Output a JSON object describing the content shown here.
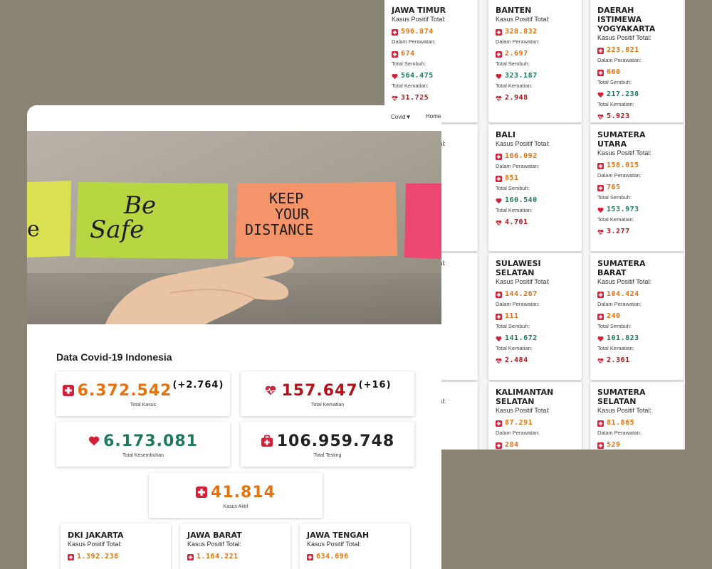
{
  "nav": {
    "covid_label": "Covid",
    "home_label": "Home"
  },
  "hero": {
    "note_left": "e",
    "note_be": "Be",
    "note_safe": "Safe",
    "note_keep": "KEEP",
    "note_your": "YOUR",
    "note_distance": "DISTANCE"
  },
  "main": {
    "title": "Data Covid-19 Indonesia",
    "total_kasus": {
      "value": "6.372.542",
      "delta": "(+2.764)",
      "caption": "Total Kasus"
    },
    "total_kematian": {
      "value": "157.647",
      "delta": "(+16)",
      "caption": "Total Kematian"
    },
    "total_kesembuhan": {
      "value": "6.173.081",
      "caption": "Total Kesembuhan"
    },
    "total_testing": {
      "value": "106.959.748",
      "caption": "Total Testing"
    },
    "kasus_aktif": {
      "value": "41.814",
      "caption": "Kasus Aktif"
    }
  },
  "labels": {
    "positif": "Kasus Positif Total:",
    "perawatan": "Dalam Perawatan:",
    "sembuh": "Total Sembuh:",
    "kematian": "Total Kematian:"
  },
  "front_provinces": [
    {
      "name": "DKI JAKARTA",
      "positif": "1.392.238"
    },
    {
      "name": "JAWA BARAT",
      "positif": "1.164.221"
    },
    {
      "name": "JAWA TENGAH",
      "positif": "634.696"
    }
  ],
  "back_provinces": [
    {
      "name": "JAWA TIMUR",
      "positif": "596.874",
      "perawatan": "674",
      "sembuh": "564.475",
      "kematian": "31.725"
    },
    {
      "name": "BANTEN",
      "positif": "328.832",
      "perawatan": "2.697",
      "sembuh": "323.187",
      "kematian": "2.948"
    },
    {
      "name": "DAERAH ISTIMEWA YOGYAKARTA",
      "positif": "223.821",
      "perawatan": "660",
      "sembuh": "217.238",
      "kematian": "5.923"
    },
    {
      "name": "H TIMUR",
      "positif": "",
      "perawatan": "",
      "sembuh": "",
      "kematian": ""
    },
    {
      "name": "BALI",
      "positif": "166.092",
      "perawatan": "851",
      "sembuh": "160.540",
      "kematian": "4.701"
    },
    {
      "name": "SUMATERA UTARA",
      "positif": "158.015",
      "perawatan": "765",
      "sembuh": "153.973",
      "kematian": "3.277"
    },
    {
      "name": "",
      "positif": "",
      "perawatan": "",
      "sembuh": "",
      "kematian": ""
    },
    {
      "name": "SULAWESI SELATAN",
      "positif": "144.267",
      "perawatan": "111",
      "sembuh": "141.672",
      "kematian": "2.484"
    },
    {
      "name": "SUMATERA BARAT",
      "positif": "104.424",
      "perawatan": "240",
      "sembuh": "101.823",
      "kematian": "2.361"
    },
    {
      "name": "ARA",
      "positif": "",
      "perawatan": "",
      "sembuh": "",
      "kematian": ""
    },
    {
      "name": "KALIMANTAN SELATAN",
      "positif": "87.291",
      "perawatan": "284",
      "sembuh": "",
      "kematian": ""
    },
    {
      "name": "SUMATERA SELATAN",
      "positif": "81.865",
      "perawatan": "529",
      "sembuh": "",
      "kematian": ""
    }
  ],
  "colors": {
    "orange": "#e8710a",
    "green": "#1d7a5f",
    "red": "#b5121b",
    "icon_red": "#d6203a"
  },
  "icons": {
    "plus": "plus-square-icon",
    "heart": "heart-icon",
    "pulse": "heart-pulse-icon",
    "kit": "medical-kit-icon"
  }
}
